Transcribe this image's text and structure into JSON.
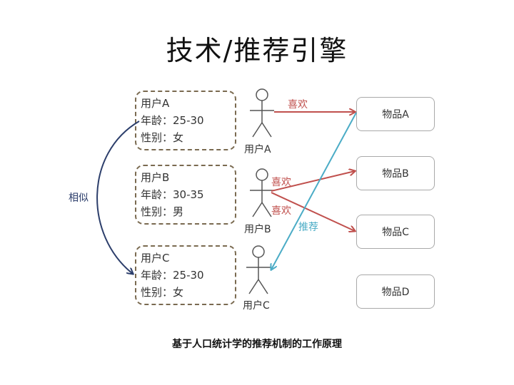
{
  "title": "技术/推荐引擎",
  "caption": "基于人口统计学的推荐机制的工作原理",
  "profiles": [
    {
      "user": "用户A",
      "age": "年龄：25-30",
      "gender": "性别：女"
    },
    {
      "user": "用户B",
      "age": "年龄：30-35",
      "gender": "性别：男"
    },
    {
      "user": "用户C",
      "age": "年龄：25-30",
      "gender": "性别：女"
    }
  ],
  "users": [
    "用户A",
    "用户B",
    "用户C"
  ],
  "items": [
    "物品A",
    "物品B",
    "物品C",
    "物品D"
  ],
  "edges": {
    "similar": "相似",
    "like_a": "喜欢",
    "like_b1": "喜欢",
    "like_b2": "喜欢",
    "recommend": "推荐"
  },
  "colors": {
    "like": "#c0504d",
    "recommend": "#4bacc6",
    "similar": "#2c3e6b",
    "dashed_border": "#7a6a50"
  }
}
